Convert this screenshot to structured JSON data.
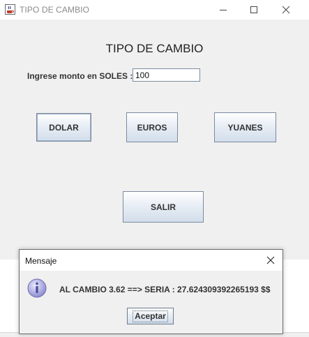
{
  "window": {
    "title": "TIPO DE CAMBIO",
    "icon": "java-cup-icon",
    "controls": [
      "minimize-icon",
      "maximize-icon",
      "close-icon"
    ]
  },
  "form": {
    "heading": "TIPO DE CAMBIO",
    "amount_label": "Ingrese monto en SOLES :",
    "amount_value": "100"
  },
  "buttons": {
    "dolar": "DOLAR",
    "euros": "EUROS",
    "yuanes": "YUANES",
    "salir": "SALIR"
  },
  "dialog": {
    "title": "Mensaje",
    "icon": "info-icon",
    "message": "AL CAMBIO 3.62 ==> SERIA  : 27.624309392265193  $$",
    "ok_label": "Aceptar"
  },
  "colors": {
    "window_bg": "#f0f0f0",
    "button_border": "#7a8aa0",
    "info_icon": "#8e8ed0"
  }
}
